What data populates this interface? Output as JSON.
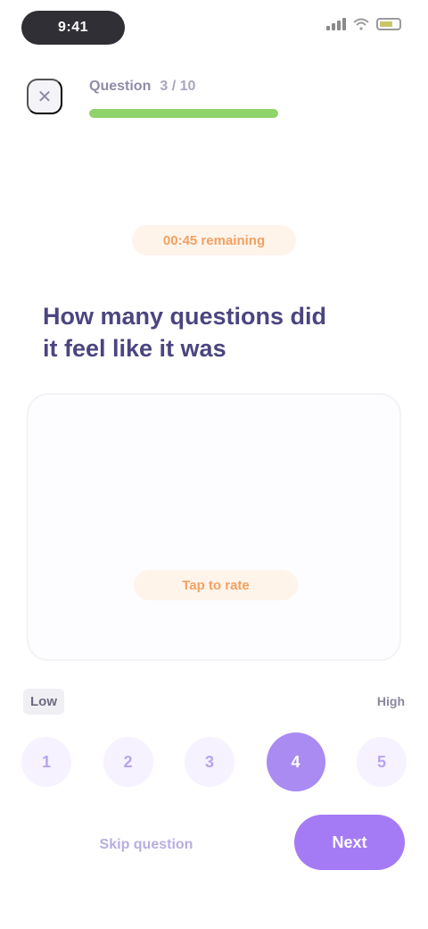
{
  "status_bar": {
    "time": "9:41"
  },
  "header": {
    "close_icon": "close-icon",
    "progress_label": "Question",
    "progress_counter": "3 / 10",
    "progress_fraction": 1.0
  },
  "timer": {
    "label": "00:45 remaining"
  },
  "question": {
    "text": "How many questions did it feel like it was"
  },
  "answer_card": {
    "reaction_label": "Tap to rate"
  },
  "scale": {
    "left_label": "Low",
    "right_label": "High",
    "options": [
      "1",
      "2",
      "3",
      "4",
      "5"
    ],
    "selected_index": 3
  },
  "footer": {
    "skip_label": "Skip question",
    "next_label": "Next"
  },
  "colors": {
    "accent": "#a57bf5",
    "progress": "#8fd36b",
    "chip": "#f3a062"
  }
}
